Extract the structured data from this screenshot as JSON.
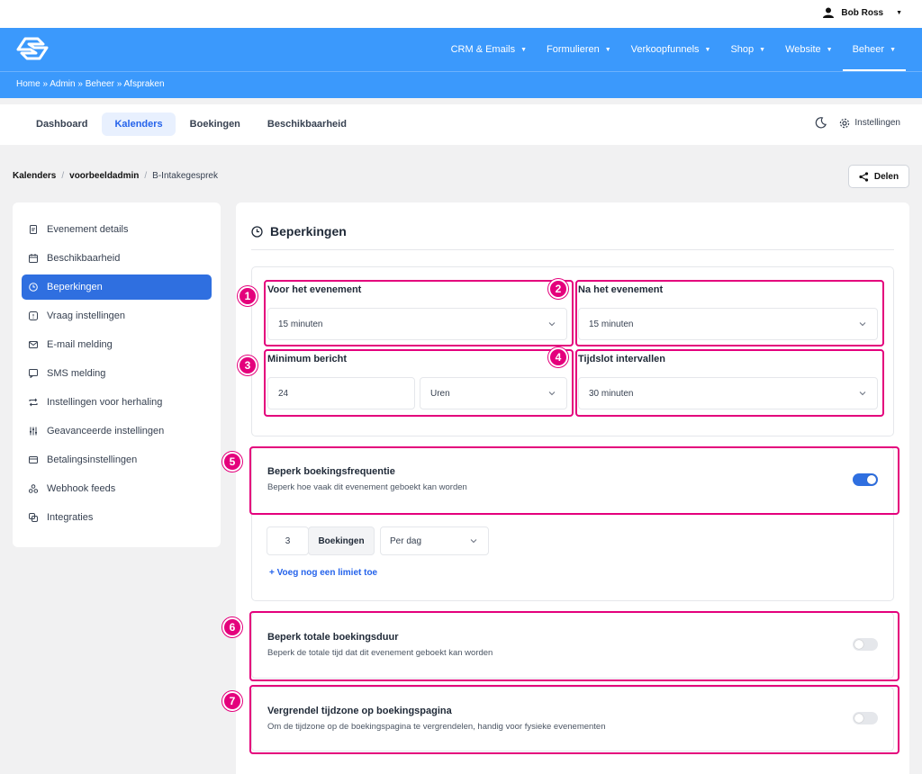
{
  "user": {
    "name": "Bob Ross"
  },
  "nav": {
    "items": [
      {
        "label": "CRM & Emails"
      },
      {
        "label": "Formulieren"
      },
      {
        "label": "Verkoopfunnels"
      },
      {
        "label": "Shop"
      },
      {
        "label": "Website"
      },
      {
        "label": "Beheer"
      }
    ],
    "active_index": 5
  },
  "breadcrumb": {
    "text": "Home » Admin » Beheer » Afspraken"
  },
  "tabs": {
    "items": [
      {
        "label": "Dashboard"
      },
      {
        "label": "Kalenders"
      },
      {
        "label": "Boekingen"
      },
      {
        "label": "Beschikbaarheid"
      }
    ],
    "active_index": 1,
    "settings_label": "Instellingen"
  },
  "crumb2": {
    "part1": "Kalenders",
    "part2": "voorbeeldadmin",
    "part3": "B-Intakegesprek",
    "sep": "/"
  },
  "share_label": "Delen",
  "sidebar": {
    "items": [
      {
        "label": "Evenement details",
        "icon": "document-icon"
      },
      {
        "label": "Beschikbaarheid",
        "icon": "calendar-icon"
      },
      {
        "label": "Beperkingen",
        "icon": "clock-icon"
      },
      {
        "label": "Vraag instellingen",
        "icon": "question-icon"
      },
      {
        "label": "E-mail melding",
        "icon": "mail-icon"
      },
      {
        "label": "SMS melding",
        "icon": "sms-icon"
      },
      {
        "label": "Instellingen voor herhaling",
        "icon": "repeat-icon"
      },
      {
        "label": "Geavanceerde instellingen",
        "icon": "sliders-icon"
      },
      {
        "label": "Betalingsinstellingen",
        "icon": "payment-icon"
      },
      {
        "label": "Webhook feeds",
        "icon": "webhook-icon"
      },
      {
        "label": "Integraties",
        "icon": "integrations-icon"
      }
    ],
    "active_index": 2
  },
  "main": {
    "title": "Beperkingen",
    "before": {
      "label": "Voor het evenement",
      "value": "15 minuten"
    },
    "after": {
      "label": "Na het evenement",
      "value": "15 minuten"
    },
    "minimum": {
      "label": "Minimum bericht",
      "value": "24",
      "unit": "Uren"
    },
    "interval": {
      "label": "Tijdslot intervallen",
      "value": "30 minuten"
    },
    "freq": {
      "title": "Beperk boekingsfrequentie",
      "desc": "Beperk hoe vaak dit evenement geboekt kan worden",
      "enabled": true,
      "count": "3",
      "unit": "Boekingen",
      "period": "Per dag",
      "add_label": "+ Voeg nog een limiet toe"
    },
    "duration": {
      "title": "Beperk totale boekingsduur",
      "desc": "Beperk de totale tijd dat dit evenement geboekt kan worden",
      "enabled": false
    },
    "timezone": {
      "title": "Vergrendel tijdzone op boekingspagina",
      "desc": "Om de tijdzone op de boekingspagina te vergrendelen, handig voor fysieke evenementen",
      "enabled": false
    }
  },
  "annotations": [
    "1",
    "2",
    "3",
    "4",
    "5",
    "6",
    "7"
  ],
  "colors": {
    "brand": "#3b99fc",
    "accent": "#2f6fe0",
    "highlight": "#e4007c"
  }
}
